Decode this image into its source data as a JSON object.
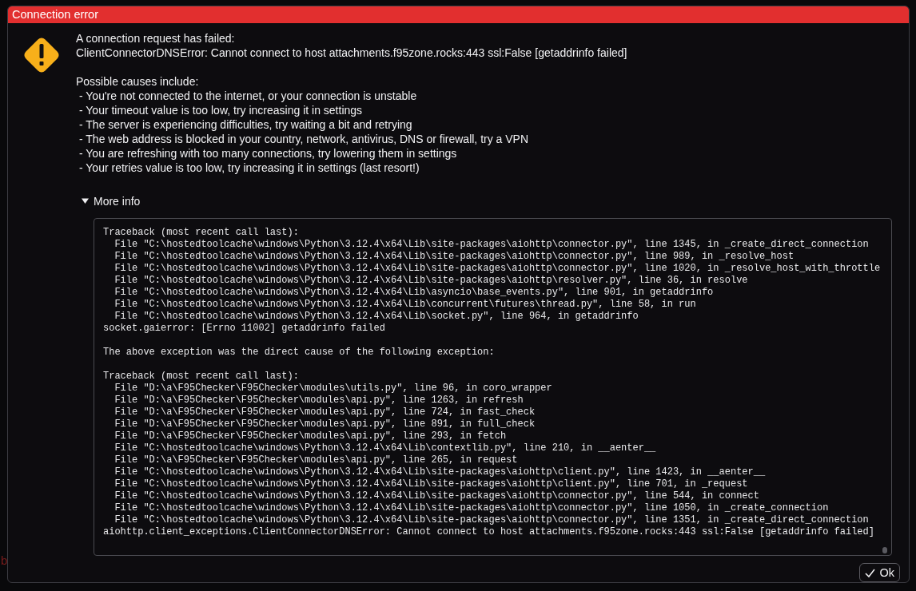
{
  "background_text": "b",
  "dialog": {
    "title": "Connection error",
    "message": [
      "A connection request has failed:",
      "ClientConnectorDNSError: Cannot connect to host attachments.f95zone.rocks:443 ssl:False [getaddrinfo failed]"
    ],
    "causes_heading": "Possible causes include:",
    "causes": [
      "- You're not connected to the internet, or your connection is unstable",
      "- Your timeout value is too low, try increasing it in settings",
      "- The server is experiencing difficulties, try waiting a bit and retrying",
      "- The web address is blocked in your country, network, antivirus, DNS or firewall, try a VPN",
      "- You are refreshing with too many connections, try lowering them in settings",
      "- Your retries value is too low, try increasing it in settings (last resort!)"
    ],
    "details": {
      "label": "More info",
      "expanded": true,
      "sections": [
        [
          "Traceback (most recent call last):",
          "  File \"C:\\hostedtoolcache\\windows\\Python\\3.12.4\\x64\\Lib\\site-packages\\aiohttp\\connector.py\", line 1345, in _create_direct_connection",
          "  File \"C:\\hostedtoolcache\\windows\\Python\\3.12.4\\x64\\Lib\\site-packages\\aiohttp\\connector.py\", line 989, in _resolve_host",
          "  File \"C:\\hostedtoolcache\\windows\\Python\\3.12.4\\x64\\Lib\\site-packages\\aiohttp\\connector.py\", line 1020, in _resolve_host_with_throttle",
          "  File \"C:\\hostedtoolcache\\windows\\Python\\3.12.4\\x64\\Lib\\site-packages\\aiohttp\\resolver.py\", line 36, in resolve",
          "  File \"C:\\hostedtoolcache\\windows\\Python\\3.12.4\\x64\\Lib\\asyncio\\base_events.py\", line 901, in getaddrinfo",
          "  File \"C:\\hostedtoolcache\\windows\\Python\\3.12.4\\x64\\Lib\\concurrent\\futures\\thread.py\", line 58, in run",
          "  File \"C:\\hostedtoolcache\\windows\\Python\\3.12.4\\x64\\Lib\\socket.py\", line 964, in getaddrinfo",
          "socket.gaierror: [Errno 11002] getaddrinfo failed"
        ],
        [
          "The above exception was the direct cause of the following exception:"
        ],
        [
          "Traceback (most recent call last):",
          "  File \"D:\\a\\F95Checker\\F95Checker\\modules\\utils.py\", line 96, in coro_wrapper",
          "  File \"D:\\a\\F95Checker\\F95Checker\\modules\\api.py\", line 1263, in refresh",
          "  File \"D:\\a\\F95Checker\\F95Checker\\modules\\api.py\", line 724, in fast_check",
          "  File \"D:\\a\\F95Checker\\F95Checker\\modules\\api.py\", line 891, in full_check",
          "  File \"D:\\a\\F95Checker\\F95Checker\\modules\\api.py\", line 293, in fetch",
          "  File \"C:\\hostedtoolcache\\windows\\Python\\3.12.4\\x64\\Lib\\contextlib.py\", line 210, in __aenter__",
          "  File \"D:\\a\\F95Checker\\F95Checker\\modules\\api.py\", line 265, in request",
          "  File \"C:\\hostedtoolcache\\windows\\Python\\3.12.4\\x64\\Lib\\site-packages\\aiohttp\\client.py\", line 1423, in __aenter__",
          "  File \"C:\\hostedtoolcache\\windows\\Python\\3.12.4\\x64\\Lib\\site-packages\\aiohttp\\client.py\", line 701, in _request",
          "  File \"C:\\hostedtoolcache\\windows\\Python\\3.12.4\\x64\\Lib\\site-packages\\aiohttp\\connector.py\", line 544, in connect",
          "  File \"C:\\hostedtoolcache\\windows\\Python\\3.12.4\\x64\\Lib\\site-packages\\aiohttp\\connector.py\", line 1050, in _create_connection",
          "  File \"C:\\hostedtoolcache\\windows\\Python\\3.12.4\\x64\\Lib\\site-packages\\aiohttp\\connector.py\", line 1351, in _create_direct_connection",
          "aiohttp.client_exceptions.ClientConnectorDNSError: Cannot connect to host attachments.f95zone.rocks:443 ssl:False [getaddrinfo failed]"
        ]
      ]
    },
    "buttons": [
      {
        "label": "Ok"
      }
    ]
  }
}
